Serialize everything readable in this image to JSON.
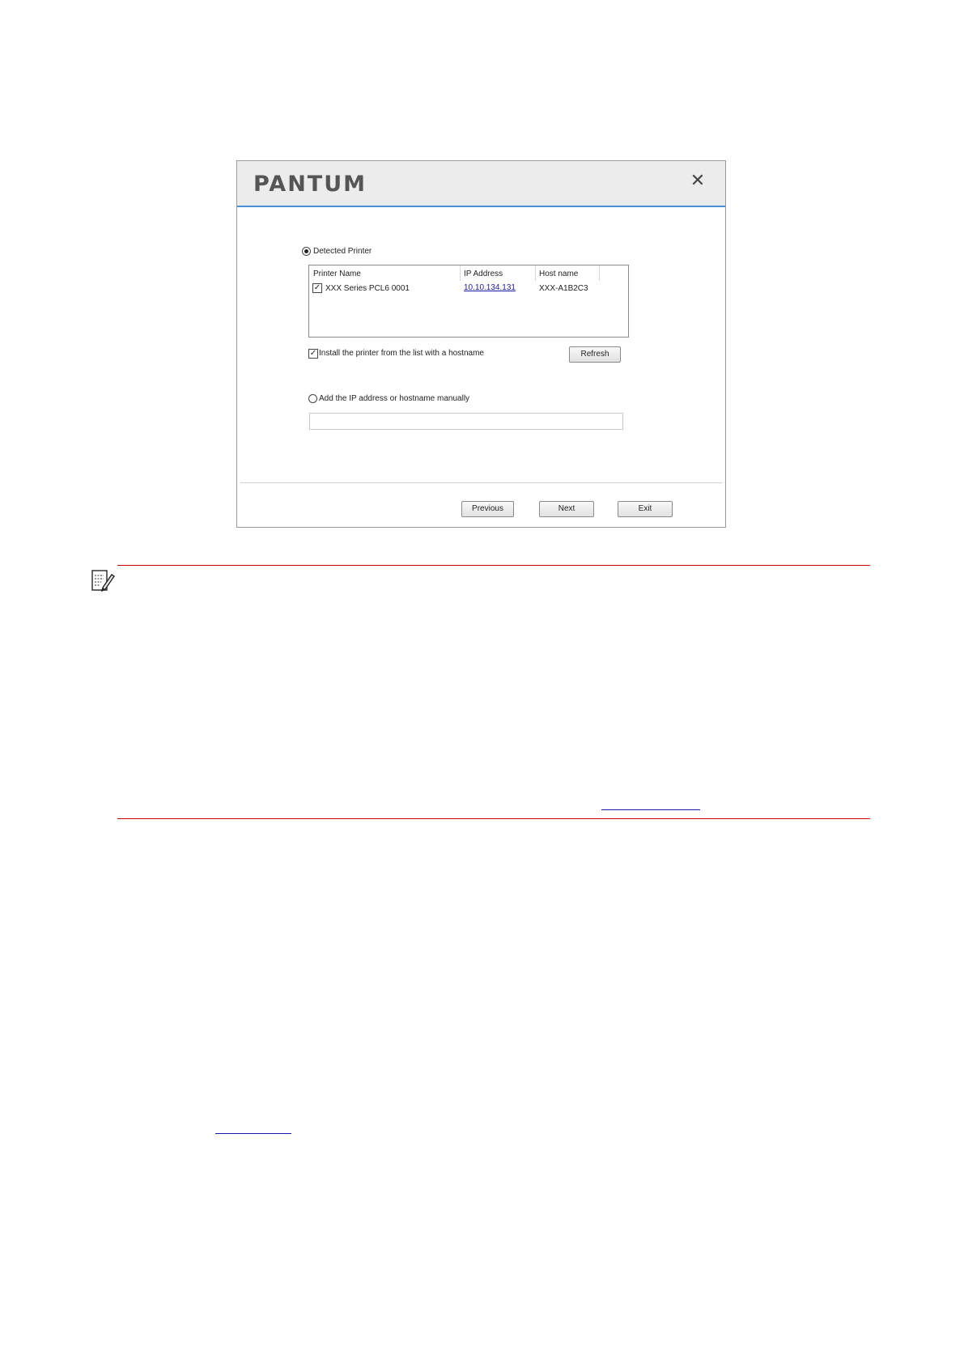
{
  "window": {
    "logo_text": "PANTUM",
    "close_symbol": "✕",
    "detected_printer_label": "Detected Printer",
    "table": {
      "headers": [
        "Printer Name",
        "IP Address",
        "Host name"
      ],
      "rows": [
        {
          "checked": true,
          "printer_name": "XXX Series PCL6 0001",
          "ip_address": "10.10.134.131",
          "host_name": "XXX-A1B2C3"
        }
      ]
    },
    "install_hostname_label": "Install the printer from the list with a hostname",
    "refresh_label": "Refresh",
    "manual_label": "Add the IP address or hostname manually",
    "manual_input_value": "",
    "previous_label": "Previous",
    "next_label": "Next",
    "exit_label": "Exit",
    "checkmark": "✓"
  },
  "icons": {
    "note": "note-pencil-icon"
  },
  "colors": {
    "rule_red": "#cc0000",
    "link_blue": "#1a1aa8",
    "header_accent": "#4a90d9"
  }
}
